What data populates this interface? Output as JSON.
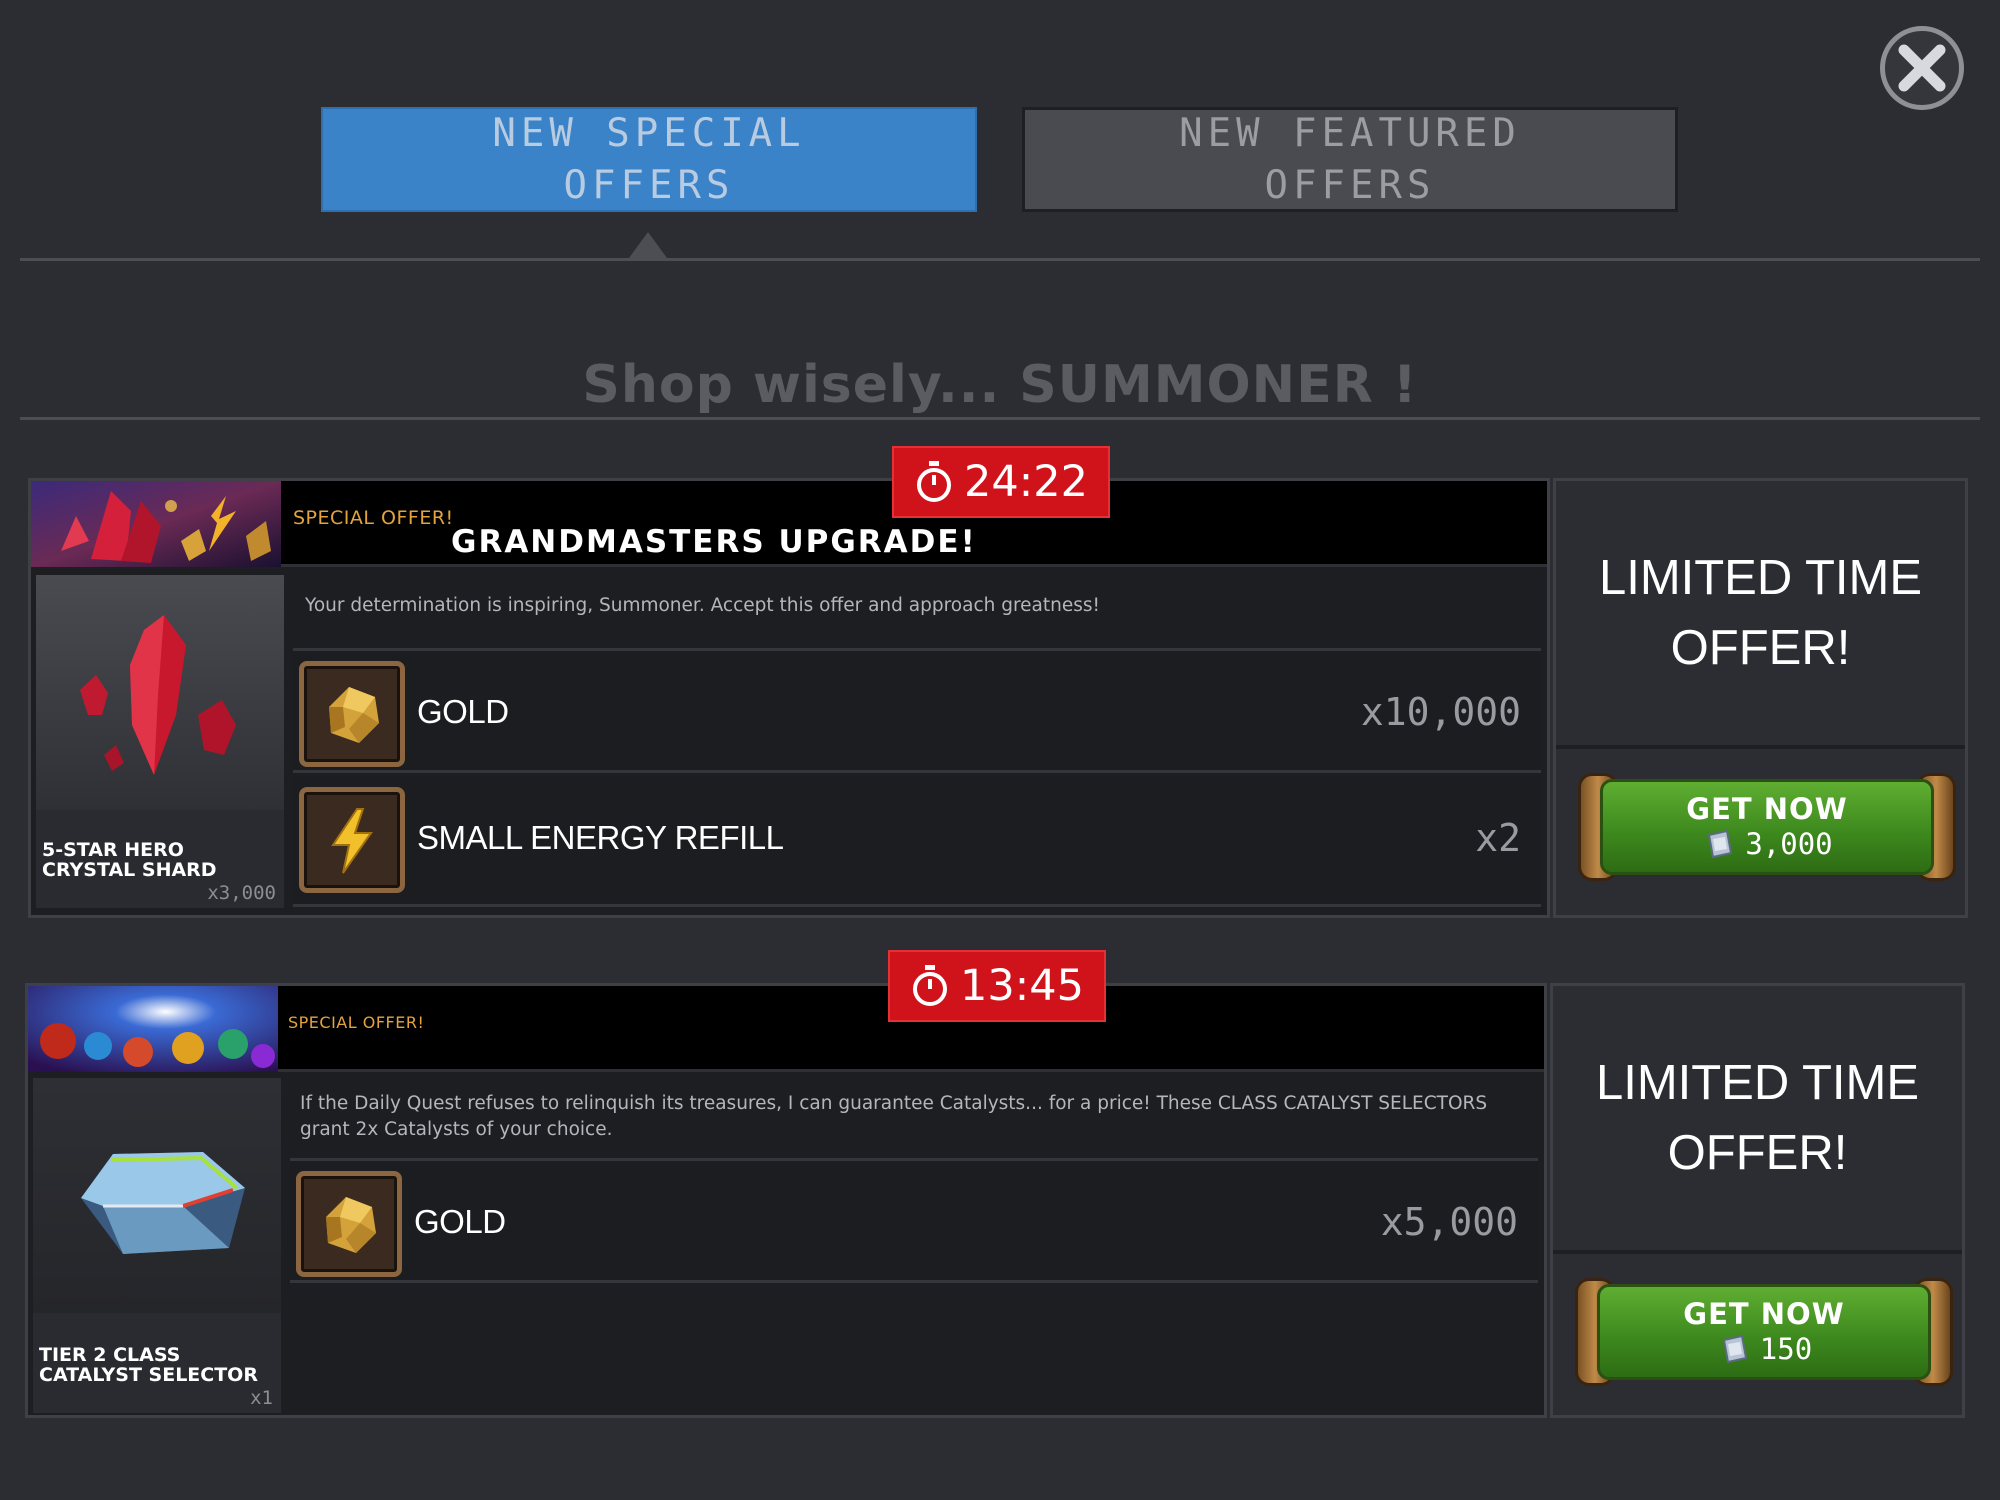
{
  "tabs": {
    "special": "NEW SPECIAL OFFERS",
    "featured": "NEW FEATURED OFFERS"
  },
  "tagline": "Shop wisely... SUMMONER !",
  "offers": [
    {
      "timer": "24:22",
      "special_label": "SPECIAL OFFER!",
      "title": "GRANDMASTERS UPGRADE!",
      "description": "Your determination is inspiring, Summoner. Accept this offer and approach greatness!",
      "item": {
        "name": "5-STAR HERO CRYSTAL SHARD",
        "quantity": "x3,000"
      },
      "rewards": [
        {
          "icon": "gold-icon",
          "label": "GOLD",
          "quantity": "x10,000"
        },
        {
          "icon": "energy-icon",
          "label": "SMALL ENERGY REFILL",
          "quantity": "x2"
        }
      ],
      "side_label": "LIMITED TIME OFFER!",
      "button": {
        "label": "GET NOW",
        "price": "3,000",
        "currency_icon": "units-icon"
      }
    },
    {
      "timer": "13:45",
      "special_label": "SPECIAL OFFER!",
      "title": "",
      "description": "If the Daily Quest refuses to relinquish its treasures, I can guarantee Catalysts... for a price! These CLASS CATALYST SELECTORS grant 2x Catalysts of your choice.",
      "item": {
        "name": "TIER 2 CLASS CATALYST SELECTOR",
        "quantity": "x1"
      },
      "rewards": [
        {
          "icon": "gold-icon",
          "label": "GOLD",
          "quantity": "x5,000"
        }
      ],
      "side_label": "LIMITED TIME OFFER!",
      "button": {
        "label": "GET NOW",
        "price": "150",
        "currency_icon": "units-icon"
      }
    }
  ],
  "colors": {
    "background": "#2b2d33",
    "tab_active": "#3a83c9",
    "tab_inactive": "#4a4b50",
    "timer": "#d0121a",
    "button_green": "#3e8a1e",
    "special_label": "#e4a43b"
  }
}
